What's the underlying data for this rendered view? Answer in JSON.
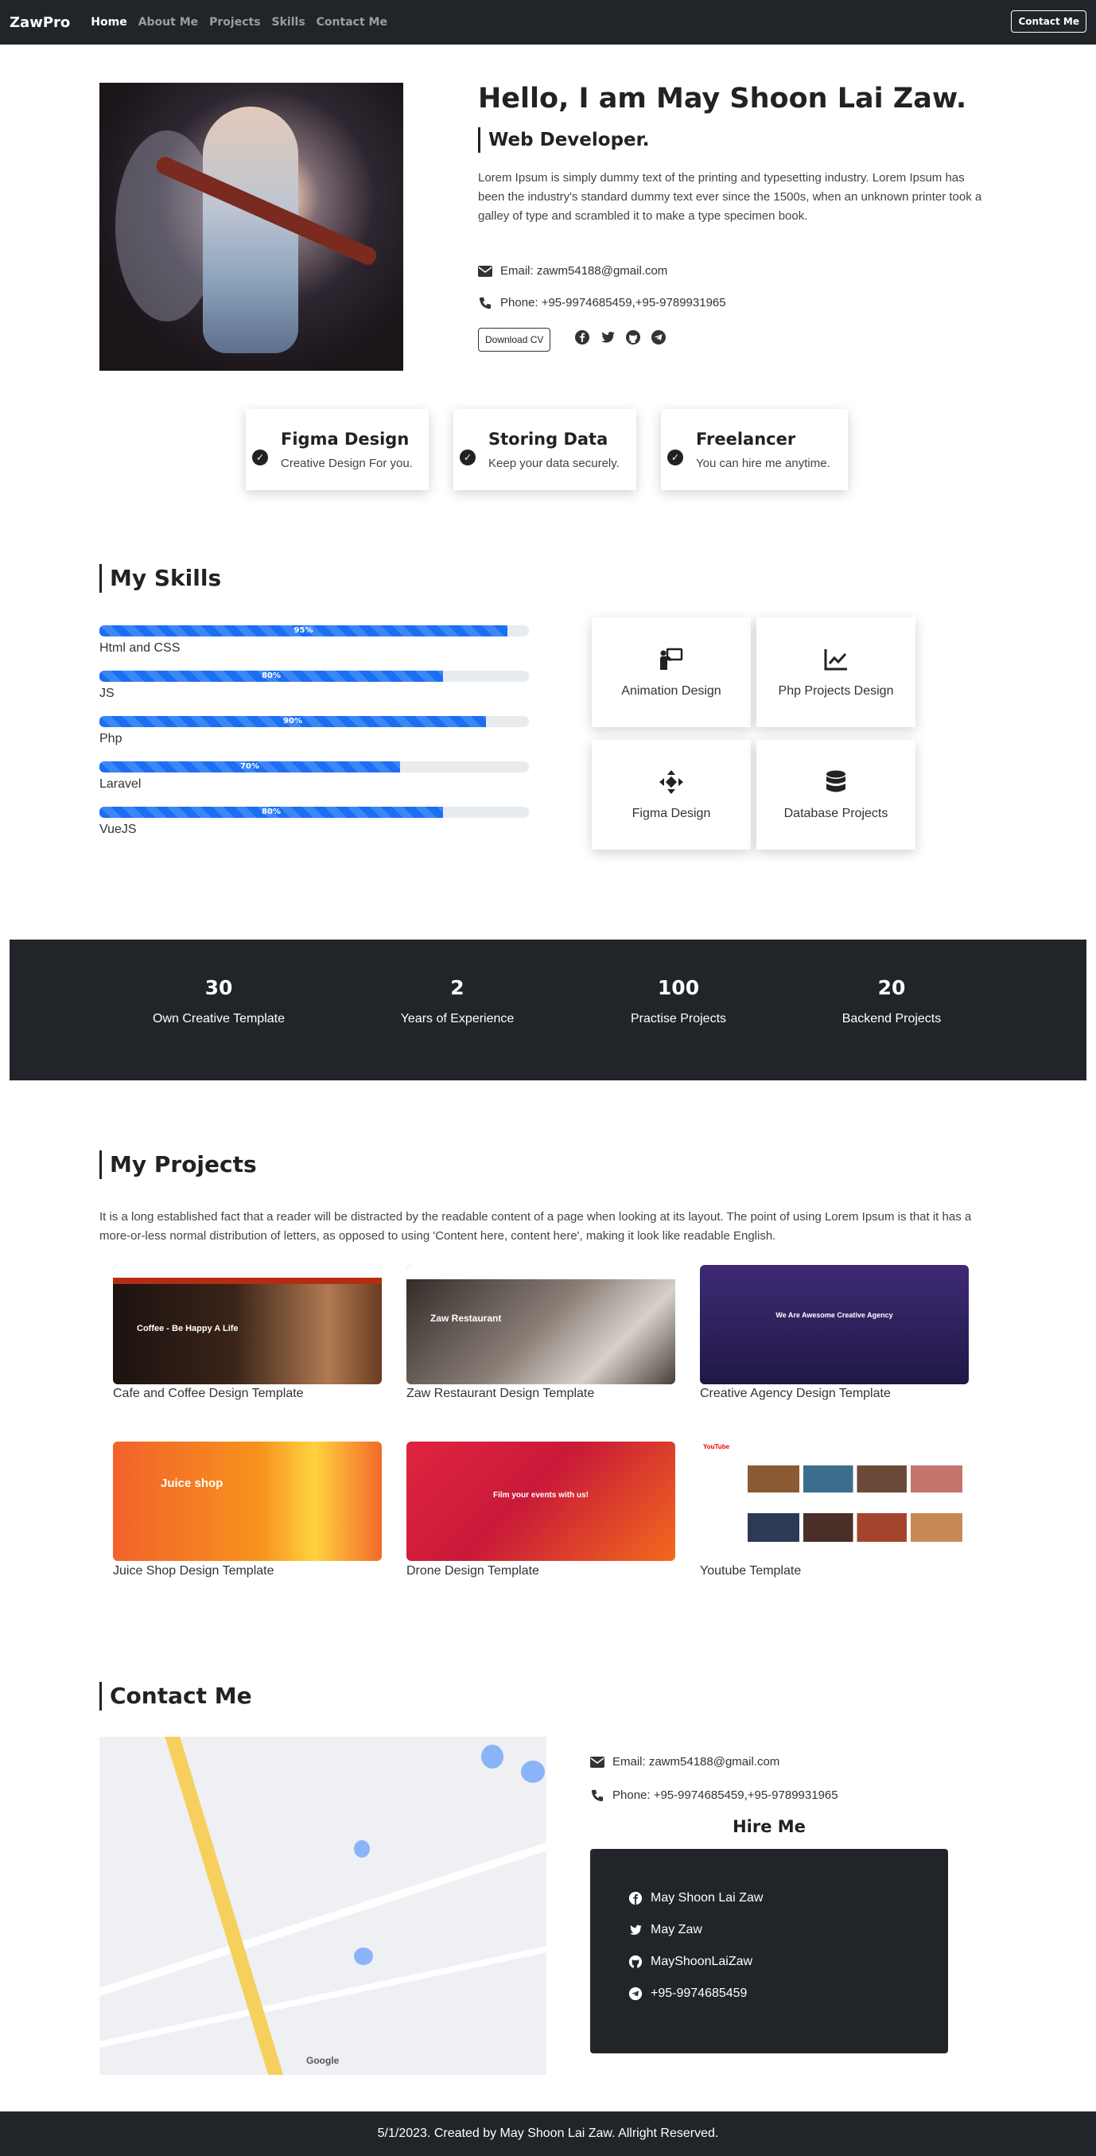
{
  "nav": {
    "brand": "ZawPro",
    "links": [
      "Home",
      "About Me",
      "Projects",
      "Skills",
      "Contact Me"
    ],
    "button": "Contact Me"
  },
  "hero": {
    "title": "Hello, I am May Shoon Lai Zaw.",
    "subtitle": "Web Developer.",
    "text": "Lorem Ipsum is simply dummy text of the printing and typesetting industry. Lorem Ipsum has been the industry's standard dummy text ever since the 1500s, when an unknown printer took a galley of type and scrambled it to make a type specimen book.",
    "email": "Email: zawm54188@gmail.com",
    "phone": "Phone: +95-9974685459,+95-9789931965",
    "cv_button": "Download CV",
    "social_icons": [
      "facebook-icon",
      "twitter-icon",
      "github-icon",
      "telegram-icon"
    ]
  },
  "features": [
    {
      "title": "Figma Design",
      "desc": "Creative Design For you."
    },
    {
      "title": "Storing Data",
      "desc": "Keep your data securely."
    },
    {
      "title": "Freelancer",
      "desc": "You can hire me anytime."
    }
  ],
  "skills": {
    "heading": "My Skills",
    "bars": [
      {
        "label": "Html and CSS",
        "percent": 95,
        "text": "95%"
      },
      {
        "label": "JS",
        "percent": 80,
        "text": "80%"
      },
      {
        "label": "Php",
        "percent": 90,
        "text": "90%"
      },
      {
        "label": "Laravel",
        "percent": 70,
        "text": "70%"
      },
      {
        "label": "VueJS",
        "percent": 80,
        "text": "80%"
      }
    ],
    "cards": [
      {
        "label": "Animation Design",
        "icon": "presenter-icon"
      },
      {
        "label": "Php Projects Design",
        "icon": "line-chart-icon"
      },
      {
        "label": "Figma Design",
        "icon": "move-icon"
      },
      {
        "label": "Database Projects",
        "icon": "database-icon"
      }
    ]
  },
  "stats": [
    {
      "number": "30",
      "label": "Own Creative Template"
    },
    {
      "number": "2",
      "label": "Years of Experience"
    },
    {
      "number": "100",
      "label": "Practise Projects"
    },
    {
      "number": "20",
      "label": "Backend Projects"
    }
  ],
  "projects": {
    "heading": "My Projects",
    "text": "It is a long established fact that a reader will be distracted by the readable content of a page when looking at its layout. The point of using Lorem Ipsum is that it has a more-or-less normal distribution of letters, as opposed to using 'Content here, content here', making it look like readable English.",
    "items": [
      {
        "title": "Cafe and Coffee Design Template",
        "thumb_text": "Coffee - Be Happy A Life",
        "color": "#3a2418"
      },
      {
        "title": "Zaw Restaurant Design Template",
        "thumb_text": "Zaw Restaurant",
        "color": "#5a5450"
      },
      {
        "title": "Creative Agency Design Template",
        "thumb_text": "We Are Awesome Creative Agency",
        "color": "#3b2a6b"
      },
      {
        "title": "Juice Shop Design Template",
        "thumb_text": "Juice shop",
        "color": "#f2712a"
      },
      {
        "title": "Drone Design Template",
        "thumb_text": "Film your events with us!",
        "color": "#d9263f"
      },
      {
        "title": "Youtube Template",
        "thumb_text": "YouTube",
        "color": "#f4f4f4"
      }
    ]
  },
  "contact": {
    "heading": "Contact Me",
    "email": "Email: zawm54188@gmail.com",
    "phone": "Phone: +95-9974685459,+95-9789931965",
    "hire_title": "Hire Me",
    "hire_items": [
      {
        "icon": "facebook-icon",
        "text": "May Shoon Lai Zaw"
      },
      {
        "icon": "twitter-icon",
        "text": "May Zaw"
      },
      {
        "icon": "github-icon",
        "text": "MayShoonLaiZaw"
      },
      {
        "icon": "telegram-icon",
        "text": "+95-9974685459"
      }
    ],
    "map_label": "Google"
  },
  "footer": "5/1/2023. Created by May Shoon Lai Zaw. Allright Reserved.",
  "colors": {
    "dark": "#212529",
    "accent": "#1a6ff2"
  }
}
